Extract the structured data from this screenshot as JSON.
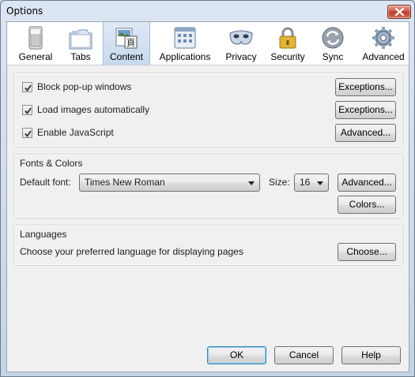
{
  "window": {
    "title": "Options"
  },
  "toolbar": {
    "panes": [
      {
        "label": "General",
        "icon": "general-icon"
      },
      {
        "label": "Tabs",
        "icon": "tabs-icon"
      },
      {
        "label": "Content",
        "icon": "content-icon",
        "selected": true
      },
      {
        "label": "Applications",
        "icon": "applications-icon"
      },
      {
        "label": "Privacy",
        "icon": "privacy-mask-icon"
      },
      {
        "label": "Security",
        "icon": "padlock-icon"
      },
      {
        "label": "Sync",
        "icon": "sync-icon"
      },
      {
        "label": "Advanced",
        "icon": "gear-icon"
      }
    ]
  },
  "content_group": {
    "checkboxes": [
      {
        "label": "Block pop-up windows",
        "checked": true
      },
      {
        "label": "Load images automatically",
        "checked": true
      },
      {
        "label": "Enable JavaScript",
        "checked": true
      }
    ],
    "buttons": [
      "Exceptions...",
      "Exceptions...",
      "Advanced..."
    ]
  },
  "fonts_colors": {
    "title": "Fonts & Colors",
    "default_font_label": "Default font:",
    "default_font_value": "Times New Roman",
    "size_label": "Size:",
    "size_value": "16",
    "advanced_button": "Advanced...",
    "colors_button": "Colors..."
  },
  "languages": {
    "title": "Languages",
    "description": "Choose your preferred language for displaying pages",
    "choose_button": "Choose..."
  },
  "footer": {
    "ok": "OK",
    "cancel": "Cancel",
    "help": "Help"
  },
  "colors": {
    "selected_tab": "#c6d8ee",
    "default_button_border": "#3c7fb1"
  }
}
